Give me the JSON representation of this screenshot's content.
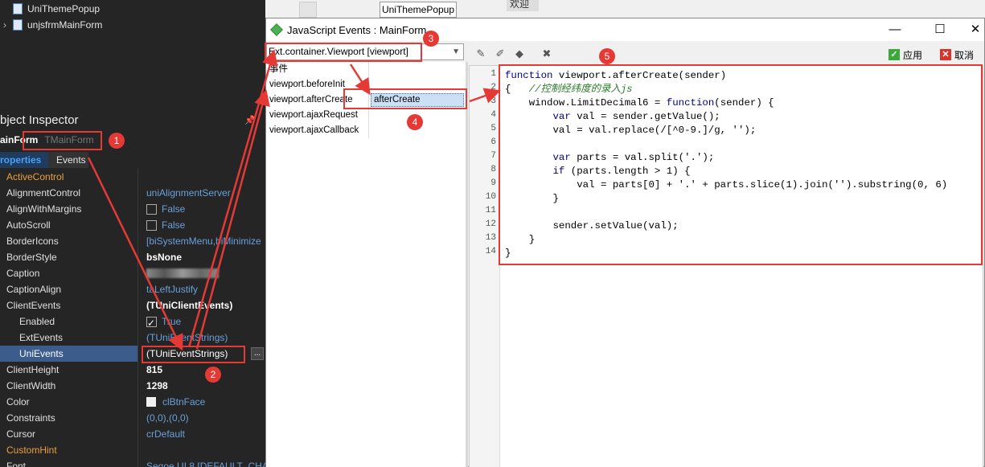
{
  "tree": {
    "items": [
      {
        "label": "UniThemePopup",
        "expanded": false
      },
      {
        "label": "unjsfrmMainForm",
        "expanded": false
      }
    ]
  },
  "background": {
    "popup_button": "UniThemePopup",
    "welcome_tab": "欢迎"
  },
  "object_inspector": {
    "title": "bject Inspector",
    "pin": "📌",
    "component_name": "ainForm",
    "component_type": "TMainForm",
    "tab_properties": "roperties",
    "tab_events": "Events",
    "properties": [
      {
        "name": "ActiveControl",
        "value": "",
        "style": "orange"
      },
      {
        "name": "AlignmentControl",
        "value": "uniAlignmentServer"
      },
      {
        "name": "AlignWithMargins",
        "value": "False",
        "check": false
      },
      {
        "name": "AutoScroll",
        "value": "False",
        "check": false
      },
      {
        "name": "BorderIcons",
        "value": "[biSystemMenu,biMinimize"
      },
      {
        "name": "BorderStyle",
        "value": "bsNone",
        "bold": true
      },
      {
        "name": "Caption",
        "value": "",
        "blur": true
      },
      {
        "name": "CaptionAlign",
        "value": "taLeftJustify"
      },
      {
        "name": "ClientEvents",
        "value": "(TUniClientEvents)",
        "bold": true
      },
      {
        "name": "Enabled",
        "value": "True",
        "check": true,
        "sub": true
      },
      {
        "name": "ExtEvents",
        "value": "(TUniEventStrings)",
        "sub": true
      },
      {
        "name": "UniEvents",
        "value": "(TUniEventStrings)",
        "sub": true,
        "selected": true
      },
      {
        "name": "ClientHeight",
        "value": "815",
        "bold": true
      },
      {
        "name": "ClientWidth",
        "value": "1298",
        "bold": true
      },
      {
        "name": "Color",
        "value": "clBtnFace",
        "swatch": true
      },
      {
        "name": "Constraints",
        "value": "(0,0),(0,0)"
      },
      {
        "name": "Cursor",
        "value": "crDefault"
      },
      {
        "name": "CustomHint",
        "value": "",
        "style": "orange"
      },
      {
        "name": "Font",
        "value": "Segoe UI 8 [DEFAULT_CHA"
      }
    ]
  },
  "dialog": {
    "title": "JavaScript Events : MainForm",
    "min": "—",
    "max": "☐",
    "close": "✕",
    "component_combo": "Ext.container.Viewport [viewport]",
    "event_header": "事件",
    "events": [
      {
        "name": "viewport.beforeInit",
        "value": ""
      },
      {
        "name": "viewport.afterCreate",
        "value": "afterCreate",
        "highlight": true
      },
      {
        "name": "viewport.ajaxRequest",
        "value": ""
      },
      {
        "name": "viewport.ajaxCallback",
        "value": ""
      }
    ],
    "apply_label": "应用",
    "cancel_label": "取消",
    "code_lines": [
      {
        "n": "1",
        "segs": [
          [
            "kw",
            "function"
          ],
          [
            "",
            " viewport.afterCreate(sender)"
          ]
        ]
      },
      {
        "n": "2",
        "segs": [
          [
            "",
            "{   "
          ],
          [
            "cm",
            "//控制经纬度的录入js"
          ]
        ]
      },
      {
        "n": "3",
        "segs": [
          [
            "",
            "    window.LimitDecimal6 = "
          ],
          [
            "kw",
            "function"
          ],
          [
            "",
            "(sender) {"
          ]
        ]
      },
      {
        "n": "4",
        "segs": [
          [
            "",
            "        "
          ],
          [
            "kw",
            "var"
          ],
          [
            "",
            " val = sender.getValue();"
          ]
        ]
      },
      {
        "n": "5",
        "segs": [
          [
            "",
            "        val = val.replace(/[^0-9.]/g, '');"
          ]
        ]
      },
      {
        "n": "6",
        "segs": [
          [
            "",
            ""
          ]
        ]
      },
      {
        "n": "7",
        "segs": [
          [
            "",
            "        "
          ],
          [
            "kw",
            "var"
          ],
          [
            "",
            " parts = val.split('.');"
          ]
        ]
      },
      {
        "n": "8",
        "segs": [
          [
            "",
            "        "
          ],
          [
            "kw",
            "if"
          ],
          [
            "",
            " (parts.length > 1) {"
          ]
        ]
      },
      {
        "n": "9",
        "segs": [
          [
            "",
            "            val = parts[0] + '.' + parts.slice(1).join('').substring(0, 6)"
          ]
        ]
      },
      {
        "n": "10",
        "segs": [
          [
            "",
            "        }"
          ]
        ]
      },
      {
        "n": "11",
        "segs": [
          [
            "",
            ""
          ]
        ]
      },
      {
        "n": "12",
        "segs": [
          [
            "",
            "        sender.setValue(val);"
          ]
        ]
      },
      {
        "n": "13",
        "segs": [
          [
            "",
            "    }"
          ]
        ]
      },
      {
        "n": "14",
        "segs": [
          [
            "",
            "}"
          ]
        ]
      }
    ]
  },
  "annotations": {
    "badges": [
      "1",
      "2",
      "3",
      "4",
      "5"
    ],
    "color": "#e53935"
  }
}
